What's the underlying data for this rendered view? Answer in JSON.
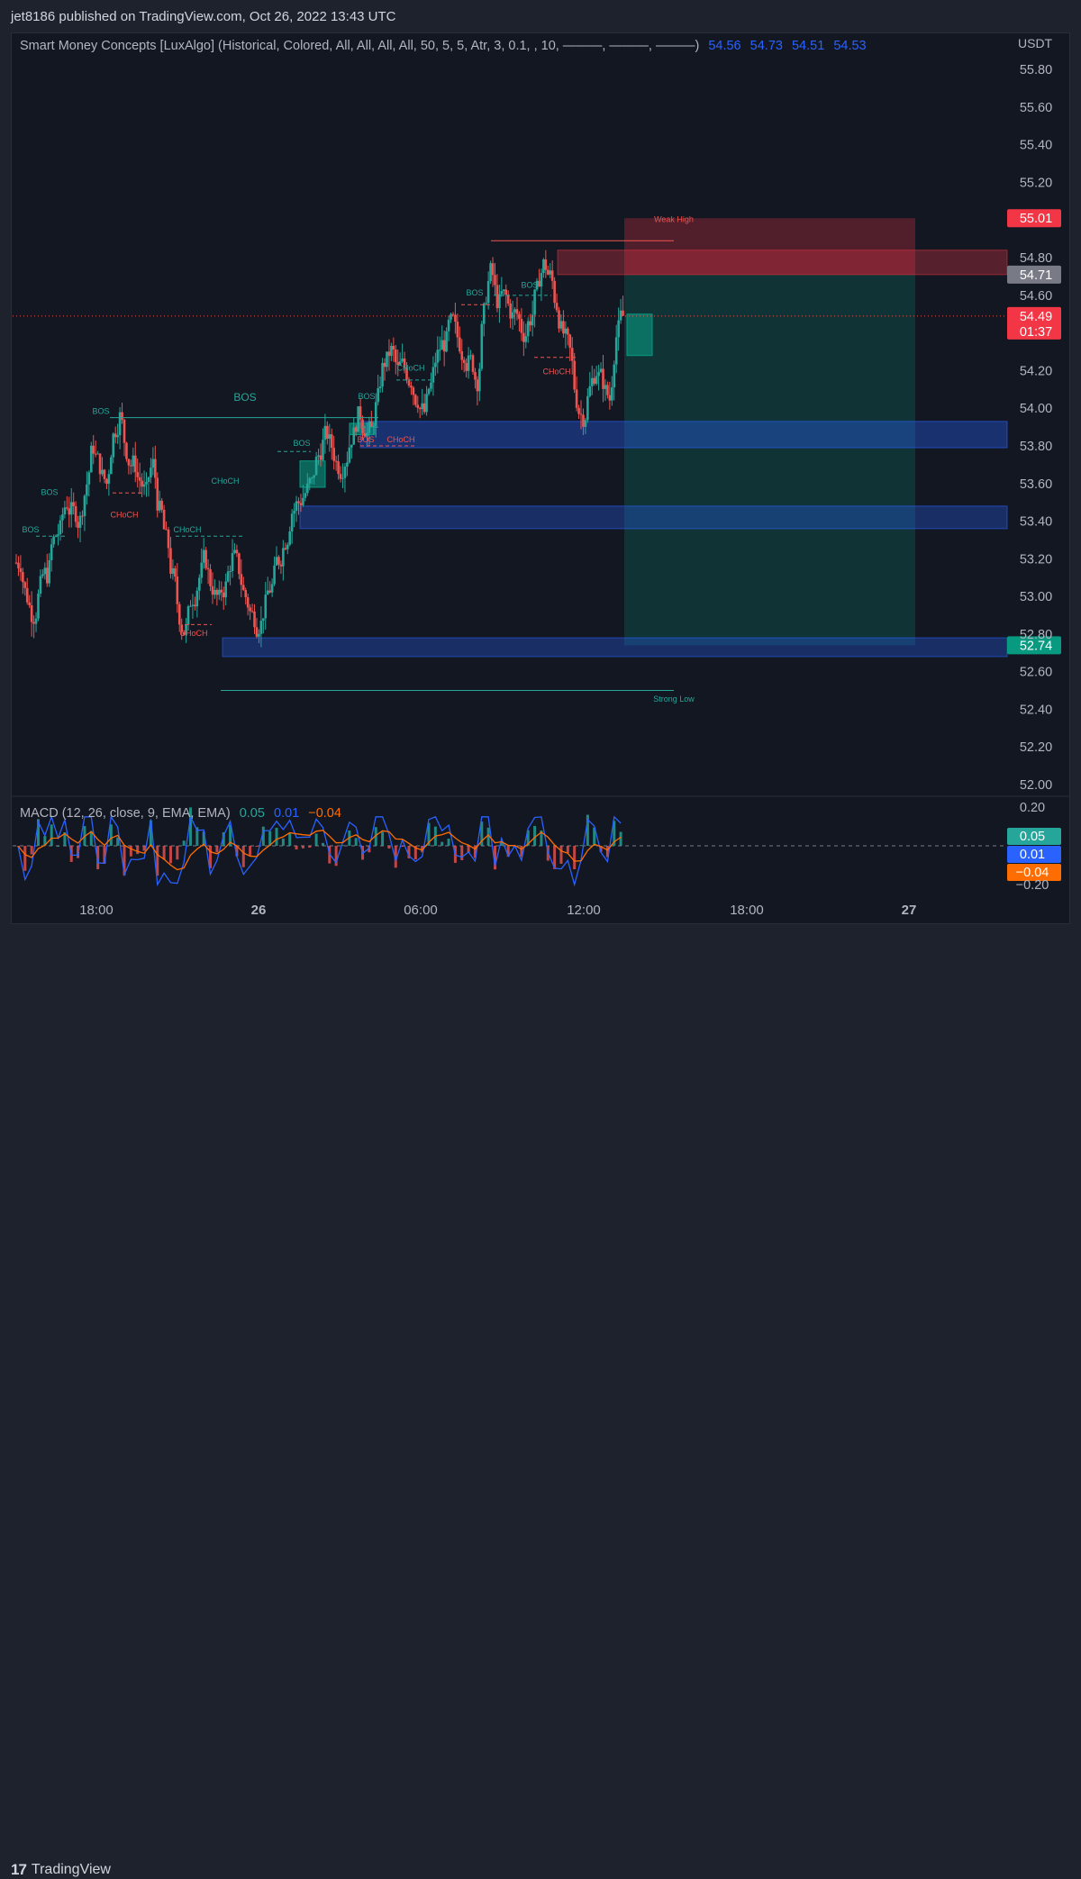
{
  "header": {
    "published": "jet8186 published on TradingView.com, Oct 26, 2022 13:43 UTC"
  },
  "indicator": {
    "title": "Smart Money Concepts [LuxAlgo] (Historical, Colored, All, All, All, All, 50, 5, 5, Atr, 3, 0.1, , 10, ―――, ―――, ―――)",
    "values": [
      "54.56",
      "54.73",
      "54.51",
      "54.53"
    ]
  },
  "currency": "USDT",
  "footer": {
    "brand": "TradingView",
    "logo_glyph": "17"
  },
  "colors": {
    "bull": "#26a69a",
    "bear": "#ef5350",
    "zone": "#2962ff",
    "macd": "#2962ff",
    "signal": "#ff6d00",
    "bg": "#131722"
  },
  "chart_data": [
    {
      "type": "candlestick",
      "symbol_quote": "USDT",
      "y_axis": {
        "ticks": [
          "55.80",
          "55.60",
          "55.40",
          "55.20",
          "54.80",
          "54.60",
          "54.20",
          "54.00",
          "53.80",
          "53.60",
          "53.40",
          "53.20",
          "53.00",
          "52.80",
          "52.60",
          "52.40",
          "52.20",
          "52.00"
        ],
        "range": [
          52.0,
          55.9
        ]
      },
      "x_axis": {
        "ticks": [
          "18:00",
          "26",
          "06:00",
          "12:00",
          "18:00",
          "27"
        ]
      },
      "price_labels": [
        {
          "value": "55.01",
          "color": "#f23645"
        },
        {
          "value": "54.71",
          "color": "#787b86"
        },
        {
          "value": "54.49",
          "color": "#f23645"
        },
        {
          "value": "52.74",
          "color": "#089981"
        }
      ],
      "countdown": "01:37",
      "current_price": 54.49,
      "close_series": [
        53.18,
        53.0,
        52.9,
        53.05,
        53.12,
        53.3,
        53.35,
        53.5,
        53.45,
        53.4,
        53.6,
        53.8,
        53.7,
        53.6,
        53.85,
        53.95,
        53.78,
        53.7,
        53.62,
        53.55,
        53.7,
        53.45,
        53.3,
        53.1,
        52.9,
        52.82,
        53.0,
        53.1,
        53.2,
        53.05,
        52.98,
        53.05,
        53.2,
        53.15,
        53.0,
        52.9,
        52.85,
        52.95,
        53.05,
        53.2,
        53.3,
        53.45,
        53.5,
        53.55,
        53.6,
        53.75,
        53.85,
        53.8,
        53.7,
        53.72,
        53.85,
        53.95,
        53.9,
        53.88,
        54.05,
        54.25,
        54.3,
        54.2,
        54.22,
        54.15,
        54.05,
        53.98,
        54.12,
        54.28,
        54.35,
        54.45,
        54.38,
        54.3,
        54.25,
        54.15,
        54.5,
        54.72,
        54.58,
        54.6,
        54.52,
        54.5,
        54.4,
        54.48,
        54.62,
        54.76,
        54.7,
        54.55,
        54.4,
        54.3,
        54.05,
        53.96,
        54.1,
        54.2,
        54.15,
        54.05,
        54.38,
        54.49
      ],
      "annotations": [
        "BOS",
        "CHoCH",
        "BOS",
        "CHoCH",
        "BOS",
        "CHoCH",
        "BOS",
        "CHoCH",
        "BOS",
        "BOS",
        "CHoCH",
        "BOS",
        "CHoCH",
        "BOS",
        "BOS",
        "CHoCH",
        "Weak High",
        "Strong Low"
      ],
      "zones": [
        {
          "kind": "order-block-bull",
          "from": 53.79,
          "to": 53.93
        },
        {
          "kind": "order-block-bull",
          "from": 53.36,
          "to": 53.48
        },
        {
          "kind": "order-block-bull",
          "from": 52.68,
          "to": 52.78
        },
        {
          "kind": "order-block-bear",
          "from": 54.71,
          "to": 54.84
        },
        {
          "kind": "premium-zone",
          "from": 54.71,
          "to": 55.01
        },
        {
          "kind": "discount-zone",
          "from": 52.74,
          "to": 54.71
        }
      ],
      "weak_high": 54.89,
      "strong_low": 52.5
    },
    {
      "type": "macd",
      "title": "MACD (12, 26, close, 9, EMA, EMA)",
      "values": {
        "histogram": "0.05",
        "macd": "0.01",
        "signal": "−0.04"
      },
      "y_axis": {
        "ticks": [
          "0.20",
          "−0.20"
        ],
        "range": [
          -0.25,
          0.25
        ]
      },
      "price_labels": [
        {
          "value": "0.05",
          "color": "#26a69a"
        },
        {
          "value": "0.01",
          "color": "#2962ff"
        },
        {
          "value": "−0.04",
          "color": "#ff6d00"
        }
      ]
    }
  ]
}
